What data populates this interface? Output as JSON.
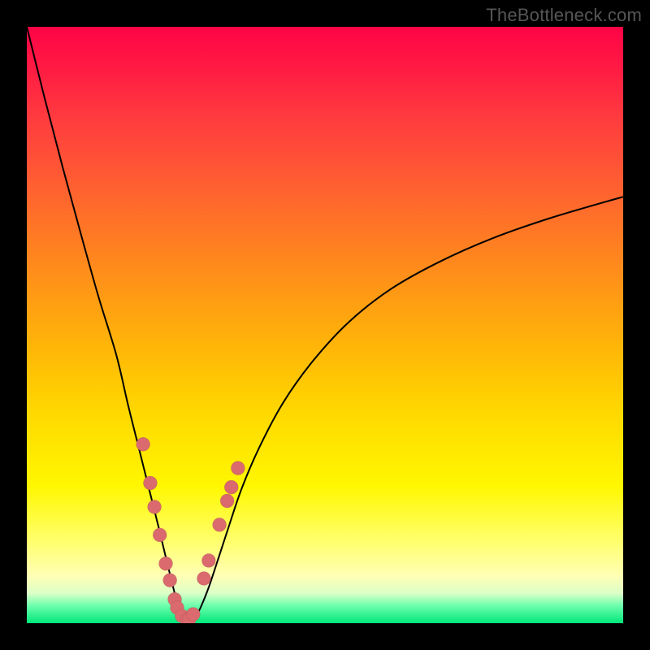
{
  "watermark": "TheBottleneck.com",
  "colors": {
    "dot_fill": "#da6a6d",
    "curve_stroke": "#000000"
  },
  "chart_data": {
    "type": "line",
    "title": "",
    "xlabel": "",
    "ylabel": "",
    "xlim": [
      0,
      100
    ],
    "ylim": [
      0,
      100
    ],
    "series": [
      {
        "name": "bottleneck-curve",
        "x": [
          0,
          3,
          6,
          9,
          12,
          15,
          17,
          19,
          20.5,
          22,
          23.2,
          24.3,
          25.2,
          26,
          26.8,
          27.5,
          28.3,
          29.3,
          30.5,
          32,
          33.8,
          36,
          39,
          43,
          48,
          54,
          61,
          69,
          78,
          88,
          100
        ],
        "values": [
          100,
          88,
          76.5,
          65.5,
          54.8,
          45,
          36.5,
          28.5,
          22.5,
          16.5,
          11.5,
          7,
          3.5,
          1.2,
          0.3,
          0.3,
          1,
          3,
          6,
          10.5,
          16,
          22.5,
          29.5,
          37,
          44,
          50.5,
          56,
          60.5,
          64.5,
          68,
          71.5
        ]
      }
    ],
    "markers": {
      "name": "highlighted-points",
      "x": [
        19.5,
        20.7,
        21.4,
        22.3,
        23.3,
        24.0,
        24.8,
        25.2,
        26.0,
        26.9,
        27.2,
        27.9,
        29.7,
        30.5,
        32.3,
        33.6,
        34.3,
        35.4
      ],
      "values": [
        30,
        23.5,
        19.5,
        14.8,
        10.0,
        7.2,
        4.0,
        2.6,
        1.2,
        0.6,
        0.6,
        1.5,
        7.5,
        10.5,
        16.5,
        20.5,
        22.8,
        26.0
      ]
    }
  }
}
